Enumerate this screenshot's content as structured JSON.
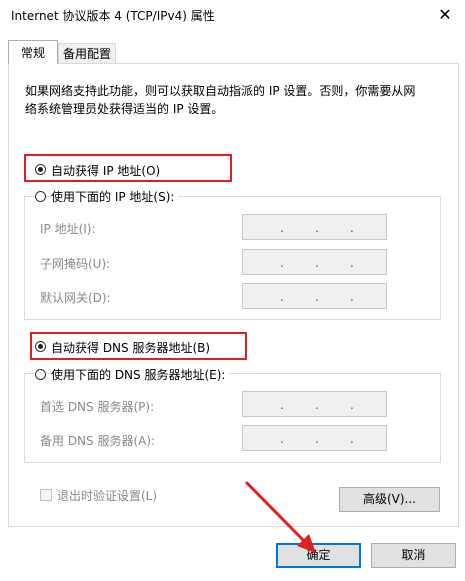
{
  "window": {
    "title": "Internet 协议版本 4 (TCP/IPv4) 属性",
    "close_glyph": "✕"
  },
  "tabs": [
    {
      "label": "常规",
      "active": true
    },
    {
      "label": "备用配置",
      "active": false
    }
  ],
  "general": {
    "description_line1": "如果网络支持此功能，则可以获取自动指派的 IP 设置。否则，你需要从网",
    "description_line2": "络系统管理员处获得适当的 IP 设置。",
    "auto_ip_label": "自动获得 IP 地址(O)",
    "auto_ip_selected": true,
    "manual_ip_label": "使用下面的 IP 地址(S):",
    "manual_ip_selected": false,
    "ip_address_label": "IP 地址(I):",
    "subnet_mask_label": "子网掩码(U):",
    "gateway_label": "默认网关(D):",
    "auto_dns_label": "自动获得 DNS 服务器地址(B)",
    "auto_dns_selected": true,
    "manual_dns_label": "使用下面的 DNS 服务器地址(E):",
    "manual_dns_selected": false,
    "preferred_dns_label": "首选 DNS 服务器(P):",
    "alternate_dns_label": "备用 DNS 服务器(A):",
    "ip_dot": ".",
    "validate_label": "退出时验证设置(L)",
    "validate_checked": false,
    "advanced_button": "高级(V)..."
  },
  "footer": {
    "ok_button": "确定",
    "cancel_button": "取消"
  },
  "annotation_colors": {
    "highlight": "#e02020",
    "arrow": "#e02020"
  }
}
